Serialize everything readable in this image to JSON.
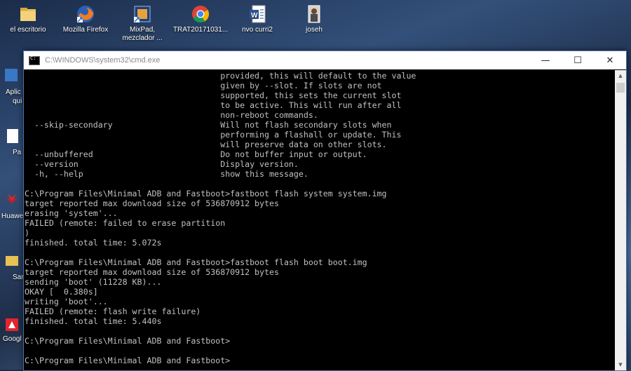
{
  "desktop": {
    "icons": [
      {
        "label": "el escritorio"
      },
      {
        "label": "Mozilla Firefox"
      },
      {
        "label": "MixPad, mezclador ..."
      },
      {
        "label": "TRAT20171031..."
      },
      {
        "label": "nvo curri2"
      },
      {
        "label": "joseh"
      }
    ],
    "left_labels": [
      "Aplic",
      "qui",
      "Pa",
      "Huawe",
      "Sar",
      "Googl"
    ]
  },
  "window": {
    "title": "C:\\WINDOWS\\system32\\cmd.exe",
    "minimize_symbol": "—",
    "maximize_symbol": "☐",
    "close_symbol": "✕"
  },
  "console": {
    "lines": [
      "                                        provided, this will default to the value",
      "                                        given by --slot. If slots are not",
      "                                        supported, this sets the current slot",
      "                                        to be active. This will run after all",
      "                                        non-reboot commands.",
      "  --skip-secondary                      Will not flash secondary slots when",
      "                                        performing a flashall or update. This",
      "                                        will preserve data on other slots.",
      "  --unbuffered                          Do not buffer input or output.",
      "  --version                             Display version.",
      "  -h, --help                            show this message.",
      "",
      "C:\\Program Files\\Minimal ADB and Fastboot>fastboot flash system system.img",
      "target reported max download size of 536870912 bytes",
      "erasing 'system'...",
      "FAILED (remote: failed to erase partition",
      ")",
      "finished. total time: 5.072s",
      "",
      "C:\\Program Files\\Minimal ADB and Fastboot>fastboot flash boot boot.img",
      "target reported max download size of 536870912 bytes",
      "sending 'boot' (11228 KB)...",
      "OKAY [  0.380s]",
      "writing 'boot'...",
      "FAILED (remote: flash write failure)",
      "finished. total time: 5.440s",
      "",
      "C:\\Program Files\\Minimal ADB and Fastboot>",
      "",
      "C:\\Program Files\\Minimal ADB and Fastboot>"
    ]
  },
  "colors": {
    "console_bg": "#000000",
    "console_text": "#c0c0c0",
    "titlebar_bg": "#ffffff",
    "window_border": "#4d6fa8"
  }
}
